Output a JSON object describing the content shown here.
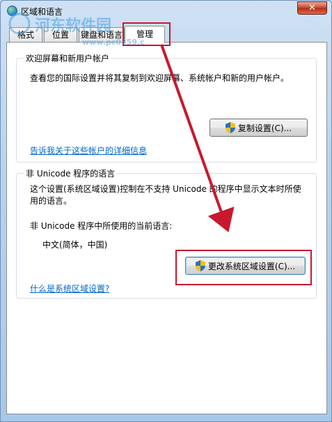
{
  "window": {
    "title": "区域和语言",
    "close_label": "✕"
  },
  "watermark": {
    "text": "河东软件园",
    "url": "www.pc0359.cn"
  },
  "tabs": [
    {
      "label": "格式"
    },
    {
      "label": "位置"
    },
    {
      "label": "键盘和语言"
    },
    {
      "label": "管理"
    }
  ],
  "welcome_group": {
    "title": "欢迎屏幕和新用户帐户",
    "description": "查看您的国际设置并将其复制到欢迎屏幕、系统帐户和新的用户帐户。",
    "copy_button": "复制设置(C)...",
    "link": "告诉我关于这些帐户的详细信息"
  },
  "unicode_group": {
    "title": "非 Unicode 程序的语言",
    "description_line1": "这个设置(系统区域设置)控制在不支持 Unicode 的程序中显示文本时所使",
    "description_line2": "用的语言。",
    "current_label": "非 Unicode 程序中所使用的当前语言:",
    "current_value": "中文(简体，中国)",
    "change_button": "更改系统区域设置(C)...",
    "link": "什么是系统区域设置?"
  },
  "colors": {
    "annotation_red": "#c8182d",
    "link_blue": "#0066cc"
  }
}
